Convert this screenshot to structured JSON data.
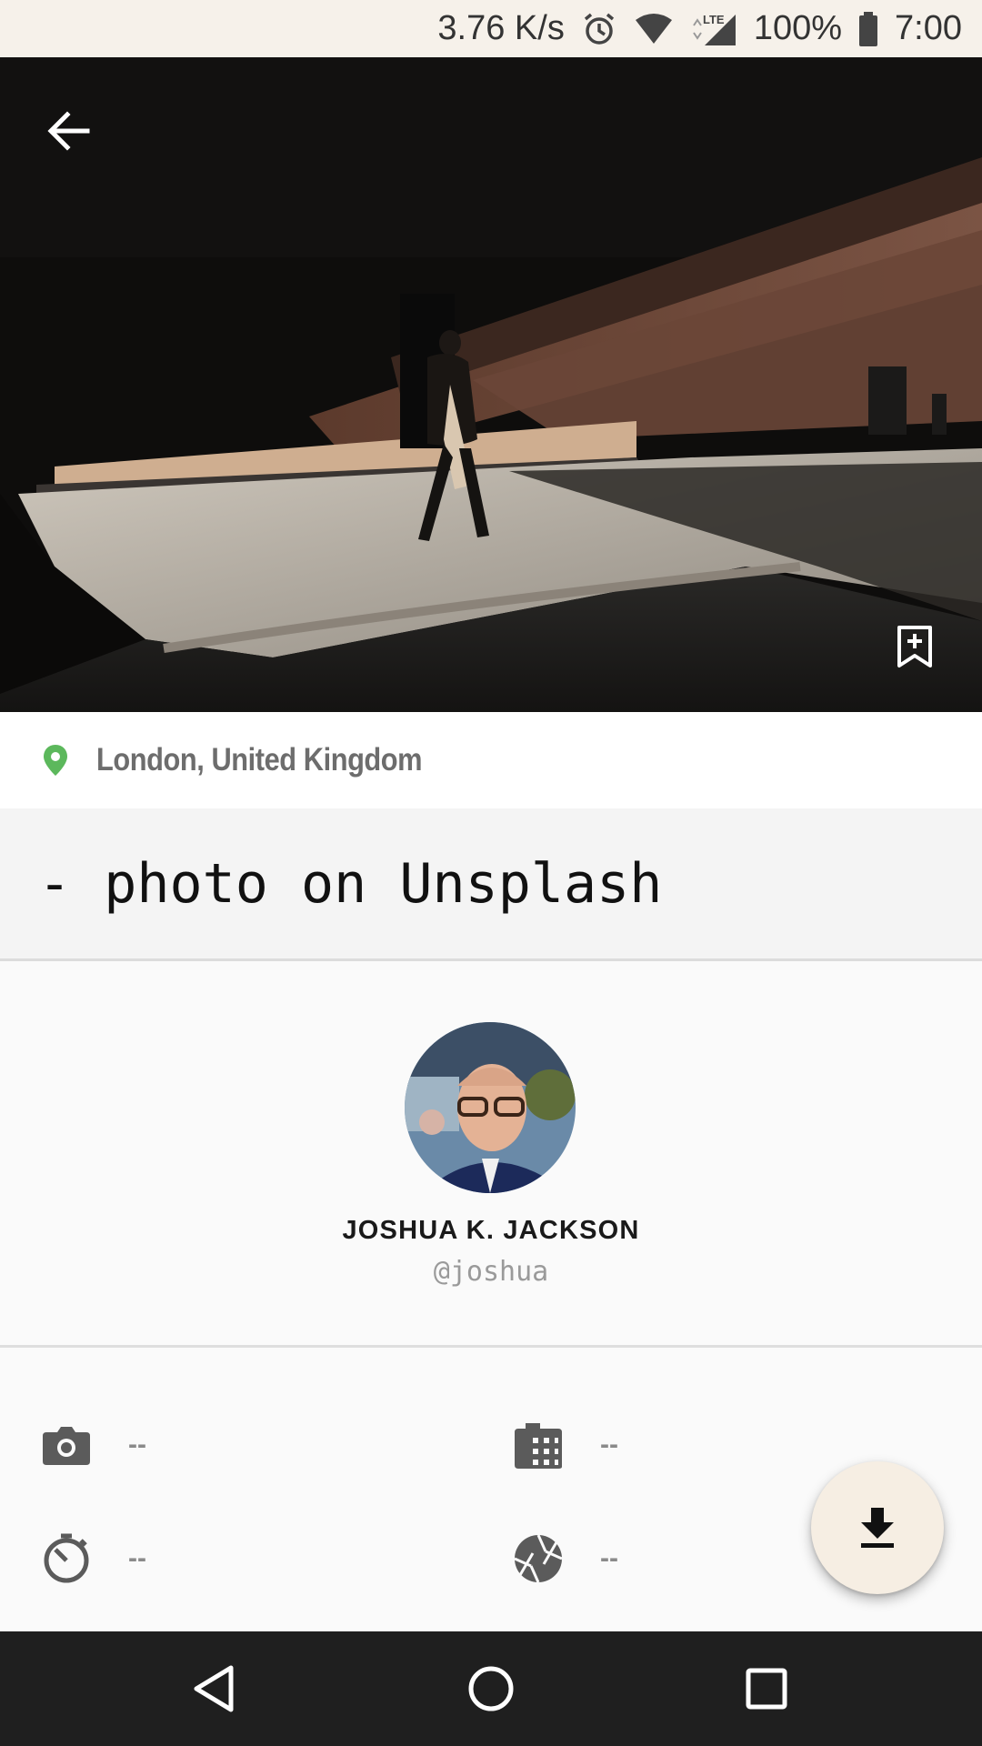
{
  "status_bar": {
    "net_speed": "3.76 K/s",
    "network_type": "LTE",
    "battery": "100%",
    "time": "7:00",
    "icons": [
      "alarm-icon",
      "wifi-icon",
      "signal-icon",
      "battery-icon"
    ]
  },
  "photo": {
    "description_icons": [
      "back-arrow-icon",
      "bookmark-add-icon"
    ]
  },
  "location": {
    "label": "London, United Kingdom",
    "icon": "location-pin-icon",
    "icon_color": "#5cb85c"
  },
  "title": "- photo on Unsplash",
  "author": {
    "name": "JOSHUA K. JACKSON",
    "handle": "@joshua"
  },
  "exif": [
    {
      "icon": "camera-icon",
      "value": "--"
    },
    {
      "icon": "film-icon",
      "value": "--"
    },
    {
      "icon": "shutter-speed-icon",
      "value": "--"
    },
    {
      "icon": "aperture-icon",
      "value": "--"
    }
  ],
  "fab": {
    "icon": "download-icon",
    "background": "#f6eee3"
  },
  "nav_bar": {
    "icons": [
      "back-triangle-icon",
      "home-circle-icon",
      "recents-square-icon"
    ]
  }
}
